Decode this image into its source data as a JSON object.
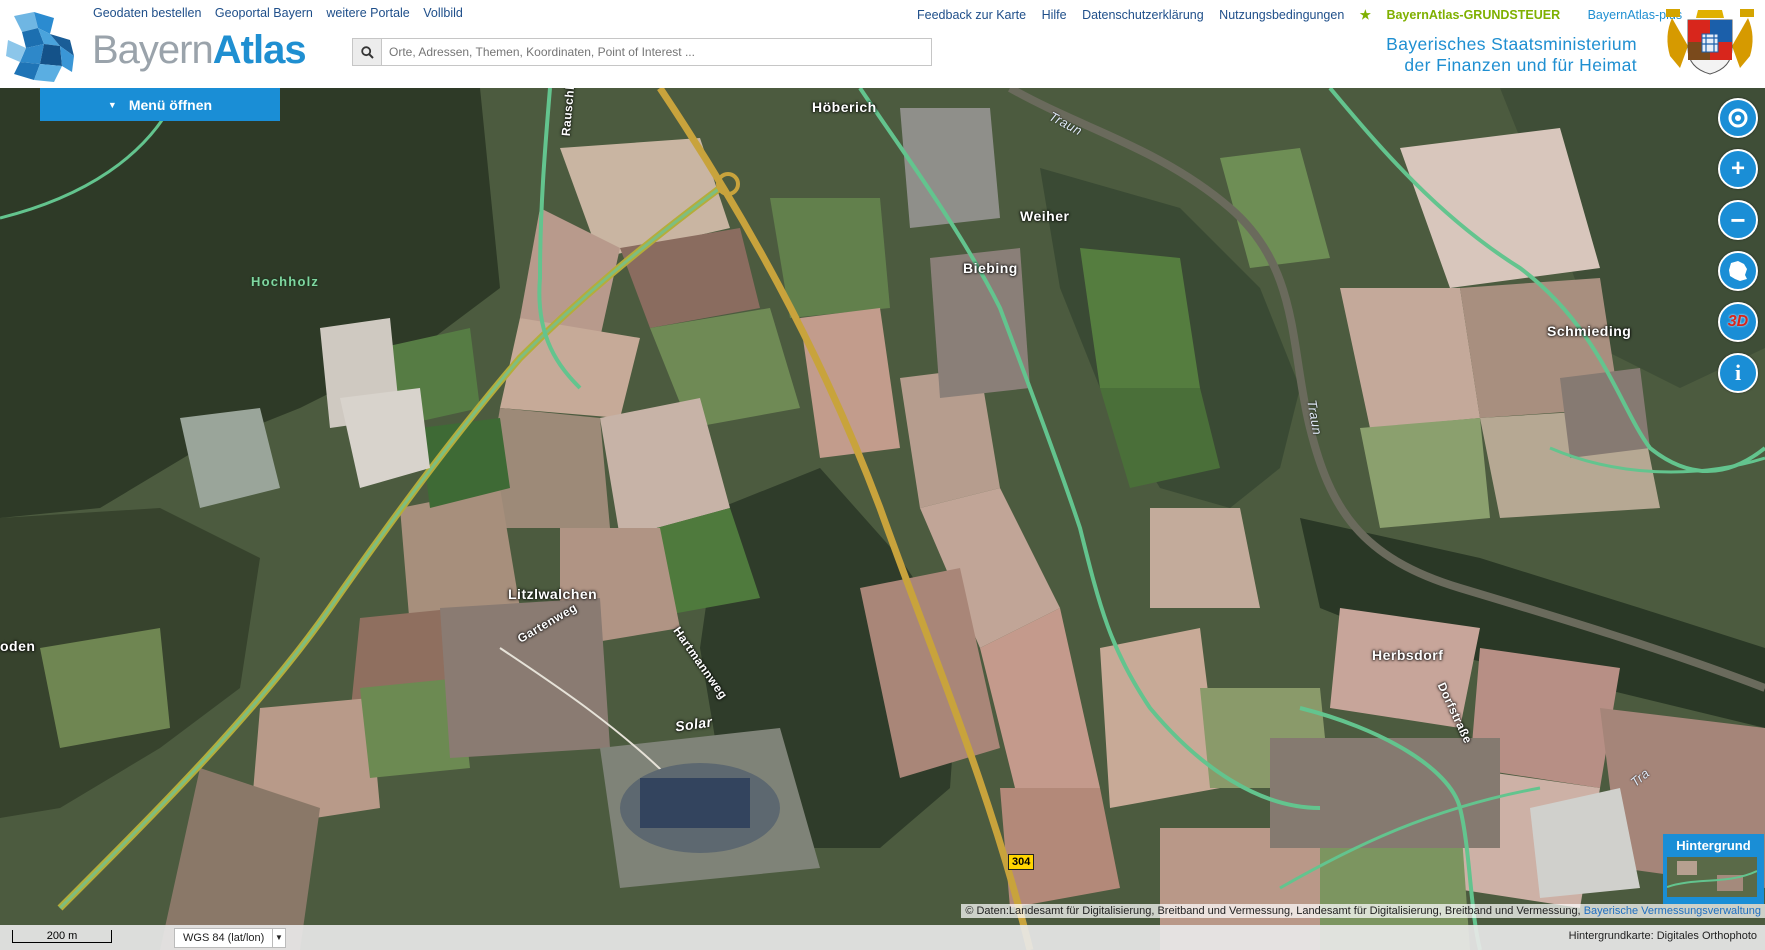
{
  "header": {
    "logo_text_light": "Bayern",
    "logo_text_bold": "Atlas",
    "top_links": [
      "Geodaten bestellen",
      "Geoportal Bayern",
      "weitere Portale",
      "Vollbild"
    ],
    "right_links": [
      "Feedback zur Karte",
      "Hilfe",
      "Datenschutzerklärung",
      "Nutzungsbedingungen"
    ],
    "grundsteuer_label": "BayernAtlas-GRUNDSTEUER",
    "plus_label": "BayernAtlas-plus",
    "search_placeholder": "Orte, Adressen, Themen, Koordinaten, Point of Interest ...",
    "ministry_line1": "Bayerisches Staatsministerium",
    "ministry_line2": "der Finanzen und für Heimat"
  },
  "menu": {
    "label": "Menü öffnen"
  },
  "map": {
    "places": {
      "hoeberich": "Höberich",
      "weiher": "Weiher",
      "biebing": "Biebing",
      "schmieding": "Schmieding",
      "hochholz": "Hochholz",
      "litzlwalchen": "Litzlwalchen",
      "herbsdorf": "Herbsdorf",
      "boden": "oden",
      "solar": "Solar"
    },
    "streets": {
      "gartenweg": "Gartenweg",
      "hartmannweg": "Hartmannweg",
      "dorfstrasse": "Dorfstraße",
      "rauschberg": "Rauschb"
    },
    "rivers": {
      "traun1": "Traun",
      "traun2": "Traun",
      "traun3": "Tra"
    },
    "route_number": "304",
    "controls": {
      "locate": "locate-icon",
      "zoom_in": "+",
      "zoom_out": "−",
      "overview": "bavaria-icon",
      "three_d": "3D",
      "info": "i"
    },
    "background_switch_label": "Hintergrund",
    "copyright_text": "© Daten:Landesamt für Digitalisierung, Breitband und Vermessung, Landesamt für Digitalisierung, Breitband und Vermessung,",
    "copyright_link": "Bayerische Vermessungsverwaltung"
  },
  "status_bar": {
    "scale_label": "200 m",
    "crs_label": "WGS 84 (lat/lon)",
    "background_info": "Hintergrundkarte: Digitales Orthophoto"
  },
  "colors": {
    "accent": "#1a8ed6",
    "grundsteuer": "#7fb000",
    "link": "#1f4f8a"
  }
}
